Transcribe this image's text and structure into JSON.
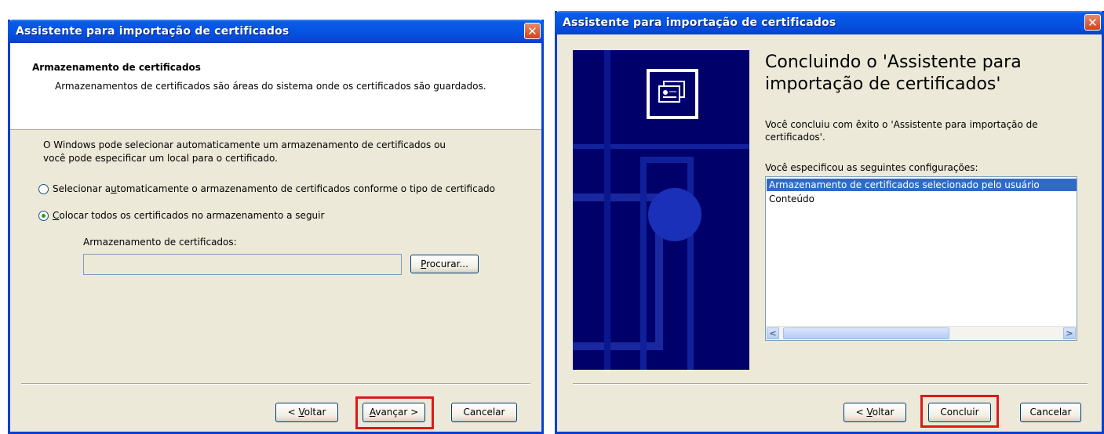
{
  "left_dialog": {
    "title": "Assistente para importação de certificados",
    "close_glyph": "✕",
    "section_title": "Armazenamento de certificados",
    "section_desc": "Armazenamentos de certificados são áreas do sistema onde os certificados são guardados.",
    "intro_line1": "O Windows pode selecionar automaticamente um armazenamento de certificados ou",
    "intro_line2": "você pode especificar um local para o certificado.",
    "radio_auto": {
      "pre": "Selecionar a",
      "accel": "u",
      "post": "tomaticamente o armazenamento de certificados conforme o tipo de certificado",
      "checked": false
    },
    "radio_manual": {
      "pre": "",
      "accel": "C",
      "post": "olocar todos os certificados no armazenamento a seguir",
      "checked": true
    },
    "store_label": "Armazenamento de certificados:",
    "store_value": "",
    "browse": {
      "accel": "P",
      "post": "rocurar..."
    },
    "back": {
      "pre": "< ",
      "accel": "V",
      "post": "oltar"
    },
    "next": {
      "pre": "",
      "accel": "A",
      "post": "vançar >"
    },
    "cancel": "Cancelar"
  },
  "right_dialog": {
    "title": "Assistente para importação de certificados",
    "close_glyph": "✕",
    "heading_line1": "Concluindo o 'Assistente para",
    "heading_line2": "importação de certificados'",
    "completed_line1": "Você concluiu com êxito o 'Assistente para importação de",
    "completed_line2": "certificados'.",
    "settings_label": "Você especificou as seguintes configurações:",
    "settings_items": [
      "Armazenamento de certificados selecionado pelo usuário",
      "Conteúdo"
    ],
    "scroll_left": "<",
    "scroll_right": ">",
    "back": {
      "pre": "< ",
      "accel": "V",
      "post": "oltar"
    },
    "finish": "Concluir",
    "cancel": "Cancelar"
  },
  "colors": {
    "highlight": "#dc1a1a",
    "titlebar": "#0554e3",
    "dialog_bg": "#ece9d8",
    "selection": "#316ac5"
  }
}
